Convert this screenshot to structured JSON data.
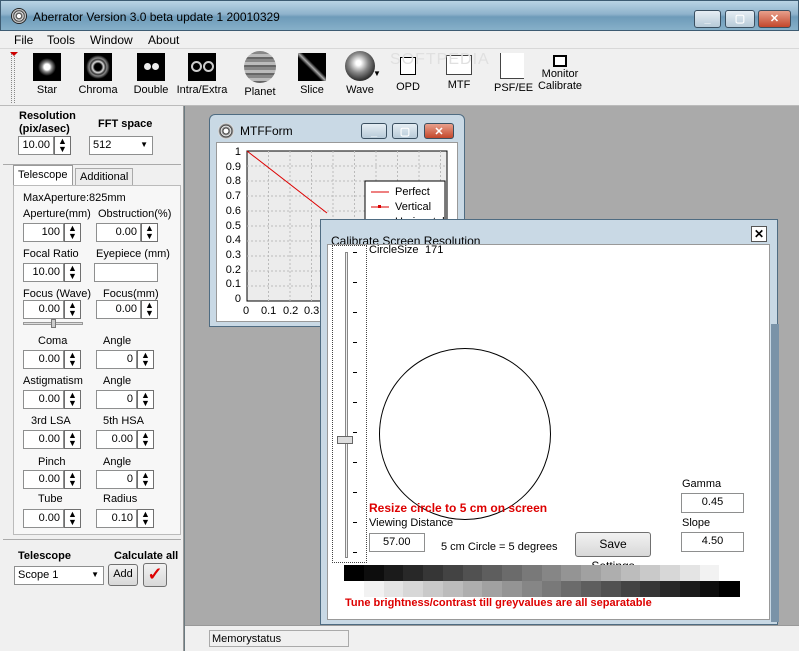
{
  "window": {
    "title": "Aberrator Version 3.0 beta update 1 20010329"
  },
  "menu": [
    "File",
    "Tools",
    "Window",
    "About"
  ],
  "toolbar": {
    "star": "Star",
    "chroma": "Chroma",
    "double": "Double",
    "intra": "Intra/Extra",
    "planet": "Planet",
    "slice": "Slice",
    "wave": "Wave",
    "opd": "OPD",
    "mtf": "MTF",
    "psfee": "PSF/EE",
    "monitor1": "Monitor",
    "monitor2": "Calibrate",
    "watermark": "SOFTPEDIA"
  },
  "left": {
    "resolution_label": "Resolution",
    "resolution_unit": "(pix/asec)",
    "resolution_value": "10.00",
    "fft_label": "FFT space",
    "fft_value": "512",
    "tab_telescope": "Telescope",
    "tab_additional": "Additional",
    "max_aperture": "MaxAperture:825mm",
    "aperture_label": "Aperture(mm)",
    "aperture_value": "100",
    "obstruction_label": "Obstruction(%)",
    "obstruction_value": "0.00",
    "focal_label": "Focal Ratio",
    "focal_value": "10.00",
    "eyepiece_label": "Eyepiece (mm)",
    "eyepiece_value": "",
    "focus_wave_label": "Focus (Wave)",
    "focus_wave_value": "0.00",
    "focus_mm_label": "Focus(mm)",
    "focus_mm_value": "0.00",
    "coma_label": "Coma",
    "coma_value": "0.00",
    "angle1_label": "Angle",
    "angle1_value": "0",
    "astig_label": "Astigmatism",
    "astig_value": "0.00",
    "angle2_label": "Angle",
    "angle2_value": "0",
    "lsa_label": "3rd LSA",
    "lsa_value": "0.00",
    "hsa_label": "5th HSA",
    "hsa_value": "0.00",
    "pinch_label": "Pinch",
    "pinch_value": "0.00",
    "angle3_label": "Angle",
    "angle3_value": "0",
    "tube_label": "Tube",
    "tube_value": "0.00",
    "radius_label": "Radius",
    "radius_value": "0.10",
    "telescope_label": "Telescope",
    "calc_label": "Calculate all",
    "scope_value": "Scope 1",
    "add_label": "Add"
  },
  "mtf": {
    "title": "MTFForm",
    "legend": [
      "Perfect",
      "Vertical",
      "Horizontal"
    ],
    "yticks": [
      "1",
      "0.9",
      "0.8",
      "0.7",
      "0.6",
      "0.5",
      "0.4",
      "0.3",
      "0.2",
      "0.1",
      "0"
    ],
    "xticks": [
      "0",
      "0.1",
      "0.2",
      "0.3"
    ]
  },
  "calib": {
    "title": "Calibrate Screen Resolution",
    "circle_size_label": "CircleSize",
    "circle_size_value": "171",
    "resize_msg": "Resize circle to 5 cm on screen",
    "viewing_label": "Viewing Distance",
    "viewing_value": "57.00",
    "circle_note": "5 cm Circle = 5 degrees",
    "save_label": "Save Settings",
    "gamma_label": "Gamma",
    "gamma_value": "0.45",
    "slope_label": "Slope",
    "slope_value": "4.50",
    "tune_msg": "Tune brightness/contrast till greyvalues are all separatable"
  },
  "status": {
    "memory": "Memorystatus"
  }
}
